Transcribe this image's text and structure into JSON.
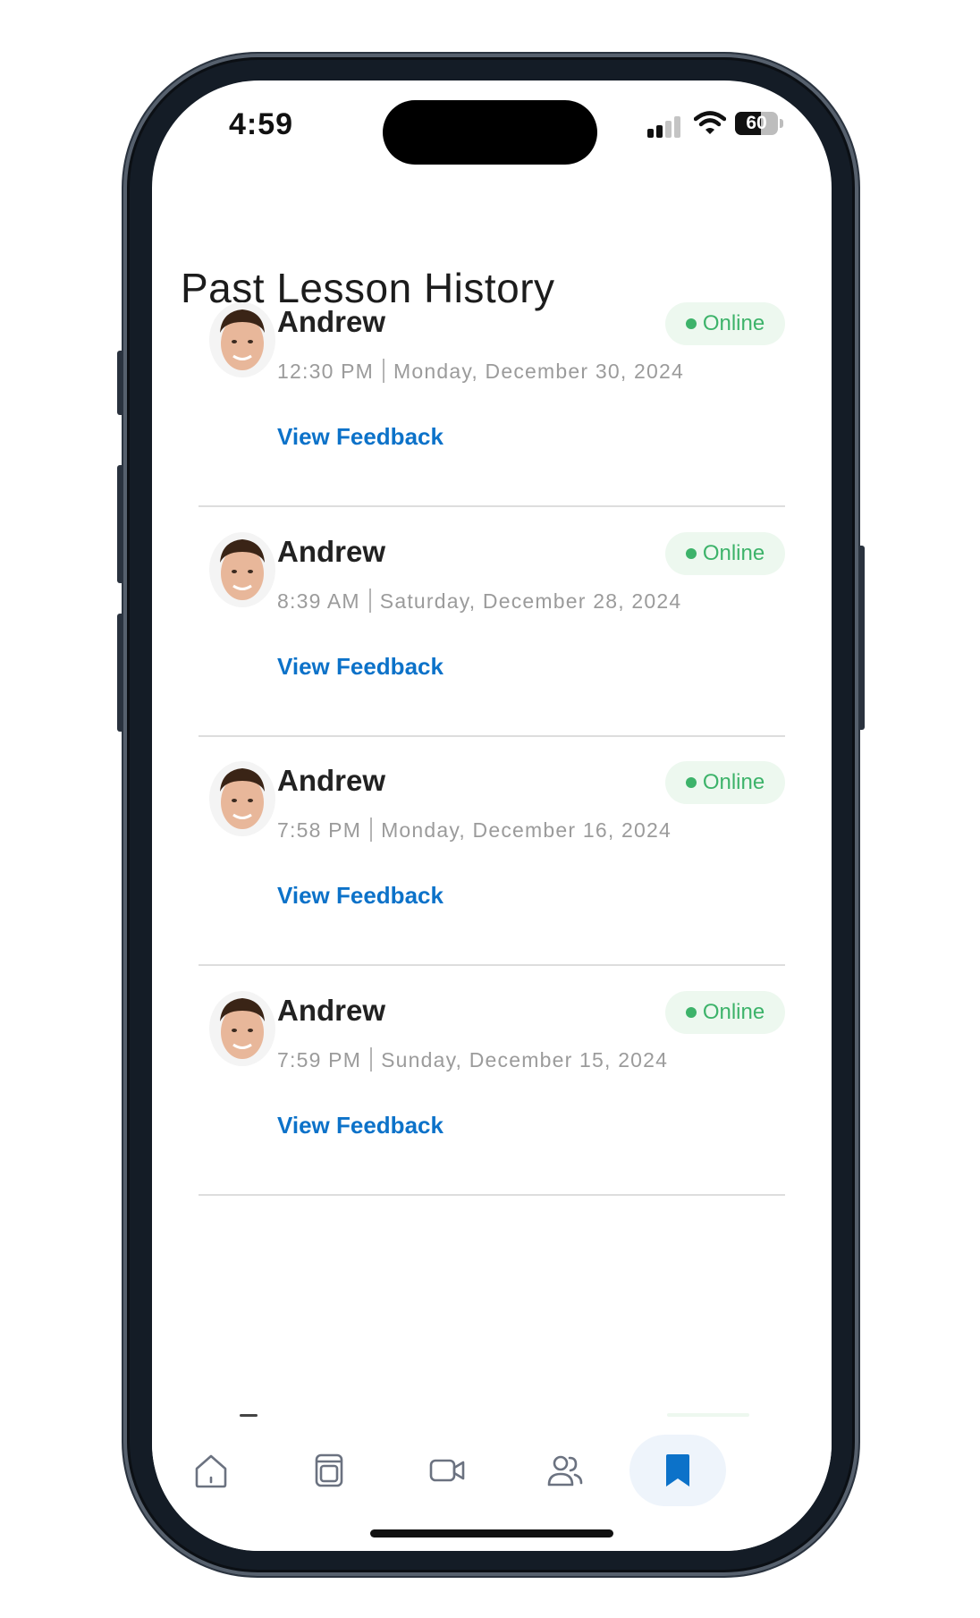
{
  "status_bar": {
    "time": "4:59",
    "battery_level": "60",
    "battery_percent": 60,
    "signal_bars": 2,
    "icons": [
      "signal-icon",
      "wifi-icon",
      "battery-icon"
    ]
  },
  "page": {
    "title": "Past Lesson History"
  },
  "lessons": [
    {
      "tutor": "Andrew",
      "status": "Online",
      "time": "12:30 PM",
      "date": "Monday, December 30, 2024",
      "action": "View Feedback"
    },
    {
      "tutor": "Andrew",
      "status": "Online",
      "time": "8:39 AM",
      "date": "Saturday, December 28, 2024",
      "action": "View Feedback"
    },
    {
      "tutor": "Andrew",
      "status": "Online",
      "time": "7:58 PM",
      "date": "Monday, December 16, 2024",
      "action": "View Feedback"
    },
    {
      "tutor": "Andrew",
      "status": "Online",
      "time": "7:59 PM",
      "date": "Sunday, December 15, 2024",
      "action": "View Feedback"
    }
  ],
  "bottom_nav": [
    {
      "icon": "home-icon",
      "active": false
    },
    {
      "icon": "lessons-icon",
      "active": false
    },
    {
      "icon": "video-icon",
      "active": false
    },
    {
      "icon": "tutors-icon",
      "active": false
    },
    {
      "icon": "bookmark-icon",
      "active": true
    }
  ],
  "colors": {
    "accent_blue": "#0c72c9",
    "online_green": "#3db36a",
    "online_bg": "#edf8ef",
    "active_nav_bg": "#eef4fb",
    "frame": "#141c26"
  }
}
